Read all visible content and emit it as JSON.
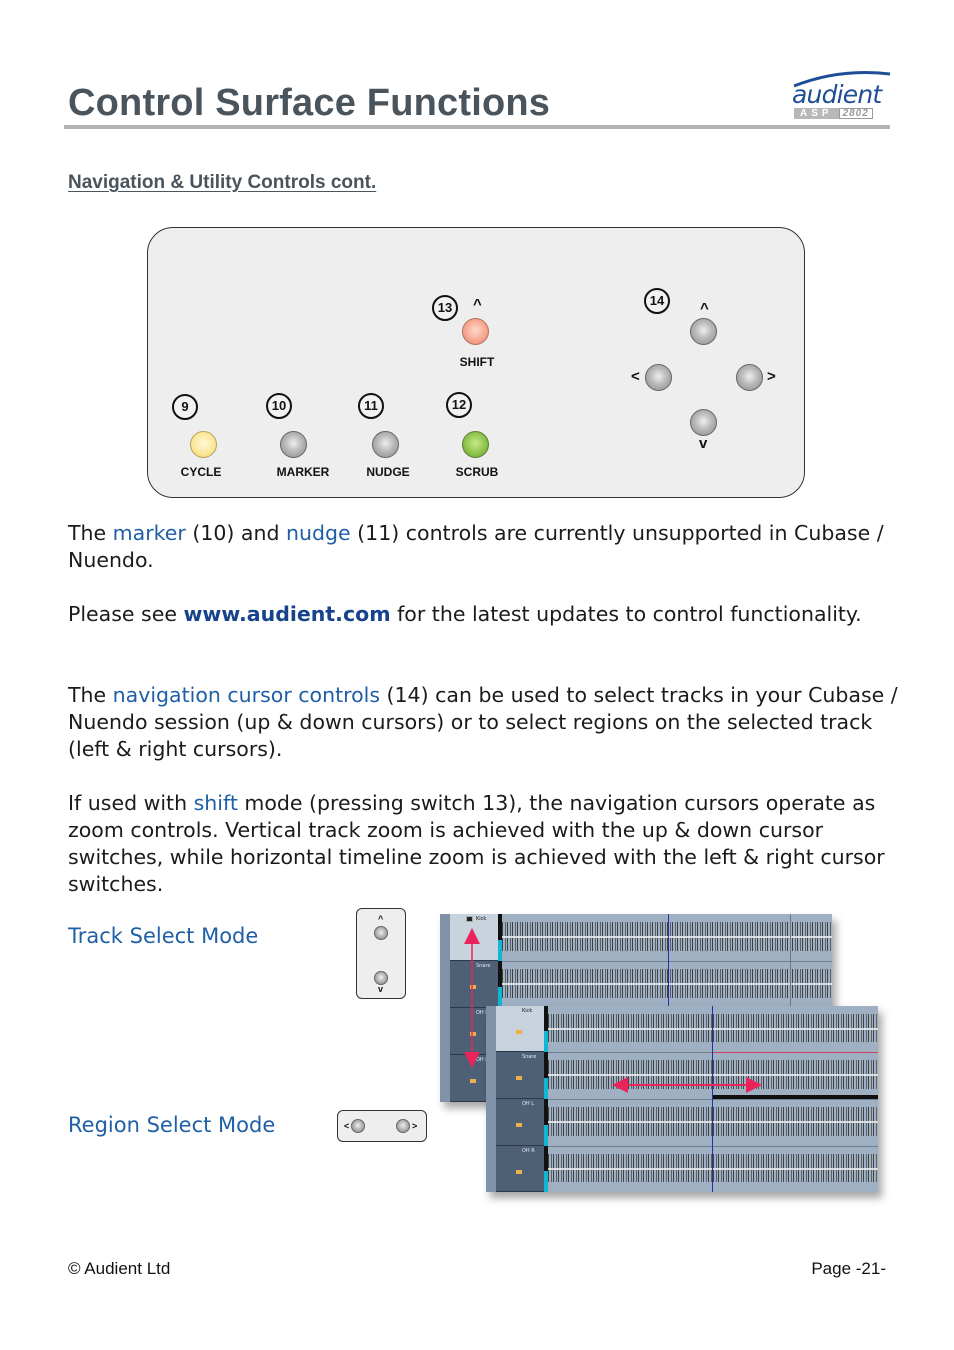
{
  "header": {
    "title": "Control Surface Functions",
    "logo": {
      "brand": "audient",
      "model_prefix": "ASP",
      "model_number": "2802"
    }
  },
  "section": {
    "heading": "Navigation & Utility Controls cont."
  },
  "panel": {
    "buttons": [
      {
        "number": "9",
        "label": "CYCLE",
        "color": "#fbe89a"
      },
      {
        "number": "10",
        "label": "MARKER",
        "color": "#b9b9b9"
      },
      {
        "number": "11",
        "label": "NUDGE",
        "color": "#b9b9b9"
      },
      {
        "number": "12",
        "label": "SCRUB",
        "color": "#8dc44c"
      },
      {
        "number": "13",
        "label": "SHIFT",
        "color": "#f7a791",
        "glyph": "^"
      }
    ],
    "cursor": {
      "number": "14",
      "up_glyph": "^",
      "down_glyph": "v",
      "left_glyph": "<",
      "right_glyph": ">"
    }
  },
  "paragraphs": {
    "p1": {
      "t1": "The ",
      "h1": "marker",
      "t2": " (10) and ",
      "h2": "nudge",
      "t3": " (11) controls are currently unsupported in Cubase / Nuendo."
    },
    "p2": {
      "t1": "Please see ",
      "link": "www.audient.com",
      "t2": " for the latest updates to control functionality."
    },
    "p3": {
      "t1": "The ",
      "h1": "navigation cursor controls",
      "t2": " (14) can be used to select tracks in your Cubase / Nuendo session (up & down cursors) or to select regions on the selected track (left & right cursors)."
    },
    "p4": {
      "t1": "If used with ",
      "h1": "shift",
      "t2": " mode (pressing switch 13), the navigation cursors operate as zoom controls. Vertical track zoom is achieved with the up & down cursor switches, while horizontal timeline zoom is achieved with the left & right cursor switches."
    }
  },
  "modes": {
    "track_select": {
      "label": "Track Select Mode",
      "up_glyph": "^",
      "down_glyph": "v"
    },
    "region_select": {
      "label": "Region Select Mode",
      "left_glyph": "<",
      "right_glyph": ">"
    }
  },
  "daw": {
    "back_tracks": [
      "Kick",
      "Snare",
      "OH L",
      "OH R"
    ],
    "front_tracks": [
      "Kick",
      "Snare",
      "OH L",
      "OH R"
    ],
    "arrow_color": "#e8245a"
  },
  "footer": {
    "copyright": "© Audient Ltd",
    "page": "Page -21-"
  },
  "colors": {
    "title": "#4a545c",
    "highlight": "#1f5fa6",
    "link": "#16438c",
    "rule": "#b3b3b3"
  }
}
